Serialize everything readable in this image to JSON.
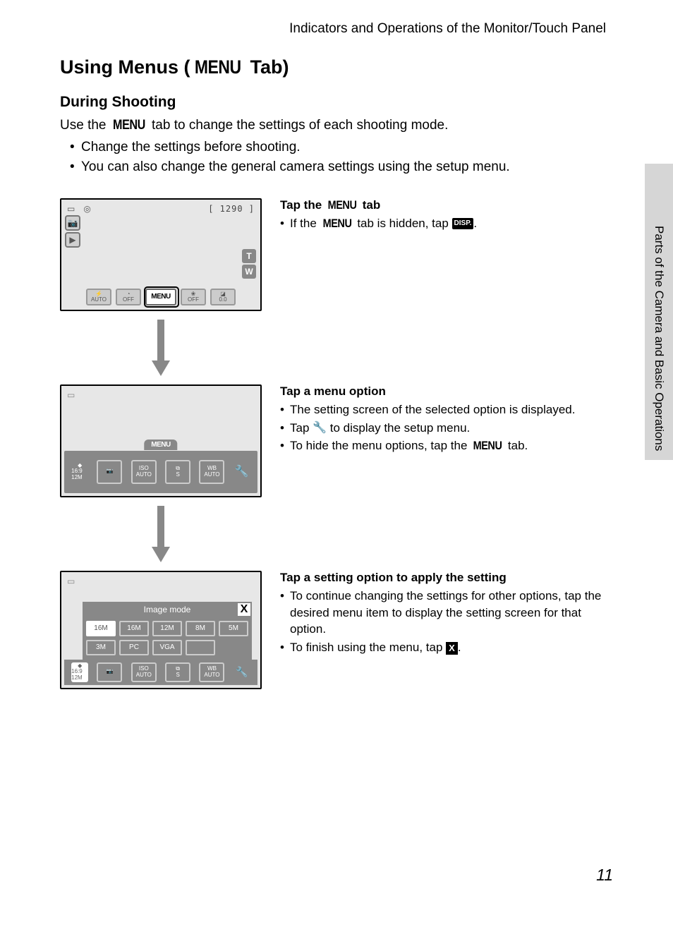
{
  "header": "Indicators and Operations of the Monitor/Touch Panel",
  "title_prefix": "Using Menus (",
  "title_menu": "MENU",
  "title_suffix": " Tab)",
  "subtitle": "During Shooting",
  "intro_pre": "Use the ",
  "intro_menu": "MENU",
  "intro_post": " tab to change the settings of each shooting mode.",
  "intro_bullets": [
    "Change the settings before shooting.",
    "You can also change the general camera settings using the setup menu."
  ],
  "side_label": "Parts of the Camera and Basic Operations",
  "page_number": "11",
  "screen1": {
    "counter": "[ 1290 ]",
    "bottom": {
      "flash": "AUTO",
      "timer": "OFF",
      "menu": "MENU",
      "macro": "OFF",
      "exp": "0.0"
    },
    "tw": {
      "t": "T",
      "w": "W"
    }
  },
  "step1": {
    "head_pre": "Tap the ",
    "head_menu": "MENU",
    "head_post": " tab",
    "bullet_pre": "If the ",
    "bullet_menu": "MENU",
    "bullet_mid": " tab is hidden, tap ",
    "bullet_disp": "DISP.",
    "bullet_post": "."
  },
  "screen2": {
    "menu_label": "MENU",
    "items": {
      "size": "16:9 12M",
      "iso_top": "ISO",
      "iso_bot": "AUTO",
      "wb_top": "WB",
      "wb_bot": "AUTO"
    }
  },
  "step2": {
    "head": "Tap a menu option",
    "b1": "The setting screen of the selected option is displayed.",
    "b2_pre": "Tap ",
    "b2_post": " to display the setup menu.",
    "b3_pre": "To hide the menu options, tap the ",
    "b3_menu": "MENU",
    "b3_post": " tab."
  },
  "screen3": {
    "panel_title": "Image mode",
    "close": "X",
    "row1": [
      "16M",
      "16M",
      "12M",
      "8M",
      "5M"
    ],
    "row2": [
      "3M",
      "PC",
      "VGA",
      ""
    ],
    "bottom": {
      "size": "16:9 12M",
      "iso_top": "ISO",
      "iso_bot": "AUTO",
      "wb_top": "WB",
      "wb_bot": "AUTO"
    }
  },
  "step3": {
    "head": "Tap a setting option to apply the setting",
    "b1": "To continue changing the settings for other options, tap the desired menu item to display the setting screen for that option.",
    "b2_pre": "To finish using the menu, tap ",
    "b2_x": "X",
    "b2_post": "."
  }
}
